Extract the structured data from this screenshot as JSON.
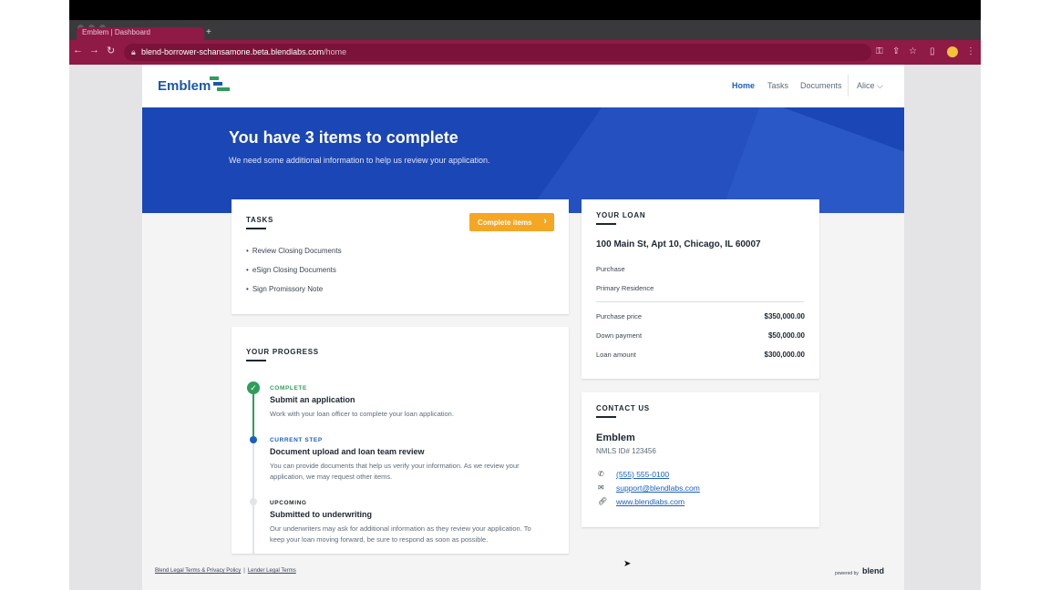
{
  "browser": {
    "tab_title": "Emblem | Dashboard",
    "new_tab": "+",
    "url_domain": "blend-borrower-schansamone.beta.blendlabs.com",
    "url_path": "/home",
    "icons": [
      "back-icon",
      "forward-icon",
      "reload-icon",
      "lock-icon",
      "key-icon",
      "share-icon",
      "star-icon",
      "sidebar-icon",
      "menu-icon"
    ],
    "accent": "#8e1a45"
  },
  "header": {
    "logo_text": "Emblem",
    "nav": [
      "Home",
      "Tasks",
      "Documents"
    ],
    "user": "Alice"
  },
  "hero": {
    "title": "You have 3 items to complete",
    "subtitle": "We need some additional information to help us review your application."
  },
  "tasks": {
    "title": "TASKS",
    "button": "Complete items",
    "items": [
      "Review Closing Documents",
      "eSign Closing Documents",
      "Sign Promissory Note"
    ]
  },
  "progress": {
    "title": "YOUR PROGRESS",
    "steps": [
      {
        "status": "COMPLETE",
        "title": "Submit an application",
        "desc": "Work with your loan officer to complete your loan application."
      },
      {
        "status": "CURRENT STEP",
        "title": "Document upload and loan team review",
        "desc": "You can provide documents that help us verify your information. As we review your application, we may request other items."
      },
      {
        "status": "UPCOMING",
        "title": "Submitted to underwriting",
        "desc": "Our underwriters may ask for additional information as they review your application. To keep your loan moving forward, be sure to respond as soon as possible."
      }
    ]
  },
  "loan": {
    "title": "YOUR LOAN",
    "address": "100 Main St, Apt 10, Chicago, IL 60007",
    "type": "Purchase",
    "occupancy": "Primary Residence",
    "rows": [
      {
        "label": "Purchase price",
        "value": "$350,000.00"
      },
      {
        "label": "Down payment",
        "value": "$50,000.00"
      },
      {
        "label": "Loan amount",
        "value": "$300,000.00"
      }
    ]
  },
  "contact": {
    "title": "CONTACT US",
    "name": "Emblem",
    "nmls": "NMLS ID# 123456",
    "phone": "(555) 555-0100",
    "email": "support@blendlabs.com",
    "website": "www.blendlabs.com"
  },
  "footer": {
    "link1": "Blend Legal Terms & Privacy Policy",
    "separator": "|",
    "link2": "Lender Legal Terms",
    "powered": "powered by",
    "brand": "blend"
  },
  "colors": {
    "primary": "#1b46b5",
    "button": "#f5a623",
    "complete": "#2e9e5b",
    "current": "#1b5fc1"
  }
}
